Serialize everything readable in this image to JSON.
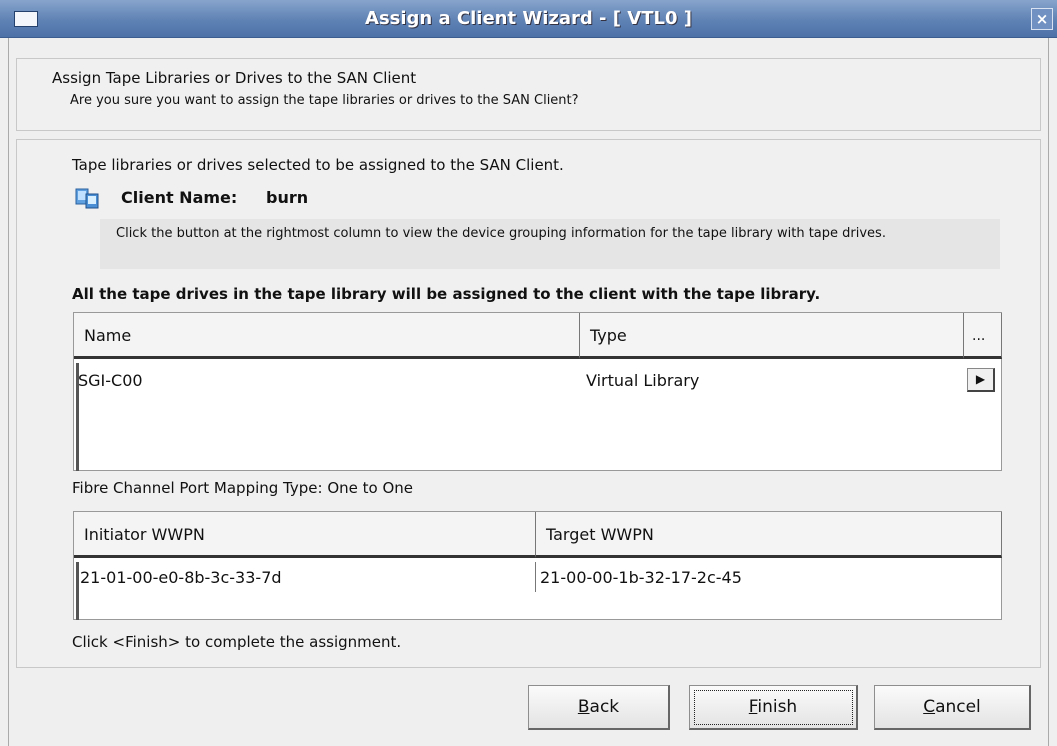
{
  "window": {
    "title": "Assign a Client Wizard - [ VTL0 ]",
    "close_glyph": "×"
  },
  "header": {
    "title": "Assign Tape Libraries or Drives to the SAN Client",
    "subtitle": "Are you sure you want to assign the tape libraries or drives to the SAN Client?"
  },
  "content": {
    "intro": "Tape libraries or drives selected to be assigned to the SAN Client.",
    "client_label": "Client Name:",
    "client_name": "burn",
    "info": "Click the button at the rightmost column to view the device grouping information for the tape library with tape drives.",
    "bold_note": "All the tape drives in the tape library will be assigned to the client with the tape library.",
    "library_table": {
      "columns": [
        "Name",
        "Type",
        "..."
      ],
      "rows": [
        {
          "name": "SGI-C00",
          "type": "Virtual Library",
          "action": "▶"
        }
      ]
    },
    "fc_label": "Fibre Channel Port Mapping Type: One to One",
    "wwpn_table": {
      "columns": [
        "Initiator WWPN",
        "Target WWPN"
      ],
      "rows": [
        {
          "initiator": "21-01-00-e0-8b-3c-33-7d",
          "target": "21-00-00-1b-32-17-2c-45"
        }
      ]
    },
    "finish_note": "Click <Finish> to complete the assignment."
  },
  "buttons": {
    "back": {
      "mnemonic": "B",
      "rest": "ack"
    },
    "finish": {
      "mnemonic": "F",
      "rest": "inish"
    },
    "cancel": {
      "mnemonic": "C",
      "rest": "ancel"
    }
  },
  "icons": {
    "client_icon": "client-computer-icon",
    "window_menu_icon": "window-menu-icon",
    "expand_icon": "play-arrow-icon"
  }
}
